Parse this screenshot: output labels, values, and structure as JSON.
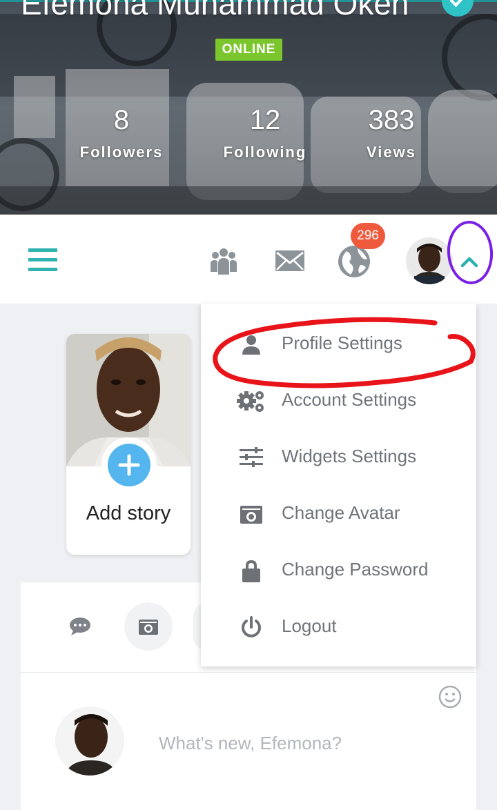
{
  "profile": {
    "name": "Efemona Muhammad Okeh",
    "status": "ONLINE",
    "stats": [
      {
        "value": "8",
        "label": "Followers"
      },
      {
        "value": "12",
        "label": "Following"
      },
      {
        "value": "383",
        "label": "Views"
      }
    ]
  },
  "navbar": {
    "icons": [
      "hamburger-menu-icon",
      "groups-icon",
      "envelope-icon",
      "globe-icon",
      "chevron-up-icon"
    ],
    "notification_count": "296"
  },
  "dropdown": {
    "items": [
      {
        "label": "Profile Settings",
        "icon": "user-icon"
      },
      {
        "label": "Account Settings",
        "icon": "gears-icon"
      },
      {
        "label": "Widgets Settings",
        "icon": "sliders-icon"
      },
      {
        "label": "Change Avatar",
        "icon": "camera-icon"
      },
      {
        "label": "Change Password",
        "icon": "lock-icon"
      },
      {
        "label": "Logout",
        "icon": "power-icon"
      }
    ]
  },
  "story": {
    "add_label": "Add story"
  },
  "composer": {
    "placeholder": "What's new, Efemona?"
  },
  "colors": {
    "accent": "#2fc3c7",
    "online": "#7bc62d",
    "badge": "#ef5a3c",
    "plus": "#55b6ef",
    "annotation_red": "#e8141a",
    "annotation_purple": "#7a20e6"
  }
}
